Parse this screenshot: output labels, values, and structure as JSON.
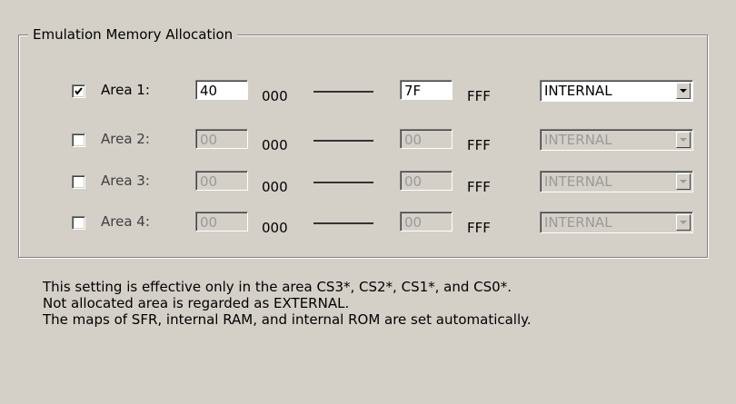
{
  "group": {
    "title": "Emulation Memory Allocation"
  },
  "rows": [
    {
      "label": "Area 1:",
      "checked": true,
      "start": "40",
      "start_suffix": "000",
      "end": "7F",
      "end_suffix": "FFF",
      "type": "INTERNAL",
      "enabled": true
    },
    {
      "label": "Area 2:",
      "checked": false,
      "start": "00",
      "start_suffix": "000",
      "end": "00",
      "end_suffix": "FFF",
      "type": "INTERNAL",
      "enabled": false
    },
    {
      "label": "Area 3:",
      "checked": false,
      "start": "00",
      "start_suffix": "000",
      "end": "00",
      "end_suffix": "FFF",
      "type": "INTERNAL",
      "enabled": false
    },
    {
      "label": "Area 4:",
      "checked": false,
      "start": "00",
      "start_suffix": "000",
      "end": "00",
      "end_suffix": "FFF",
      "type": "INTERNAL",
      "enabled": false
    }
  ],
  "notes": [
    "This setting is effective only in the area CS3*, CS2*, CS1*, and CS0*.",
    "Not allocated area is regarded as EXTERNAL.",
    "The maps of SFR, internal RAM, and internal ROM are set automatically."
  ]
}
